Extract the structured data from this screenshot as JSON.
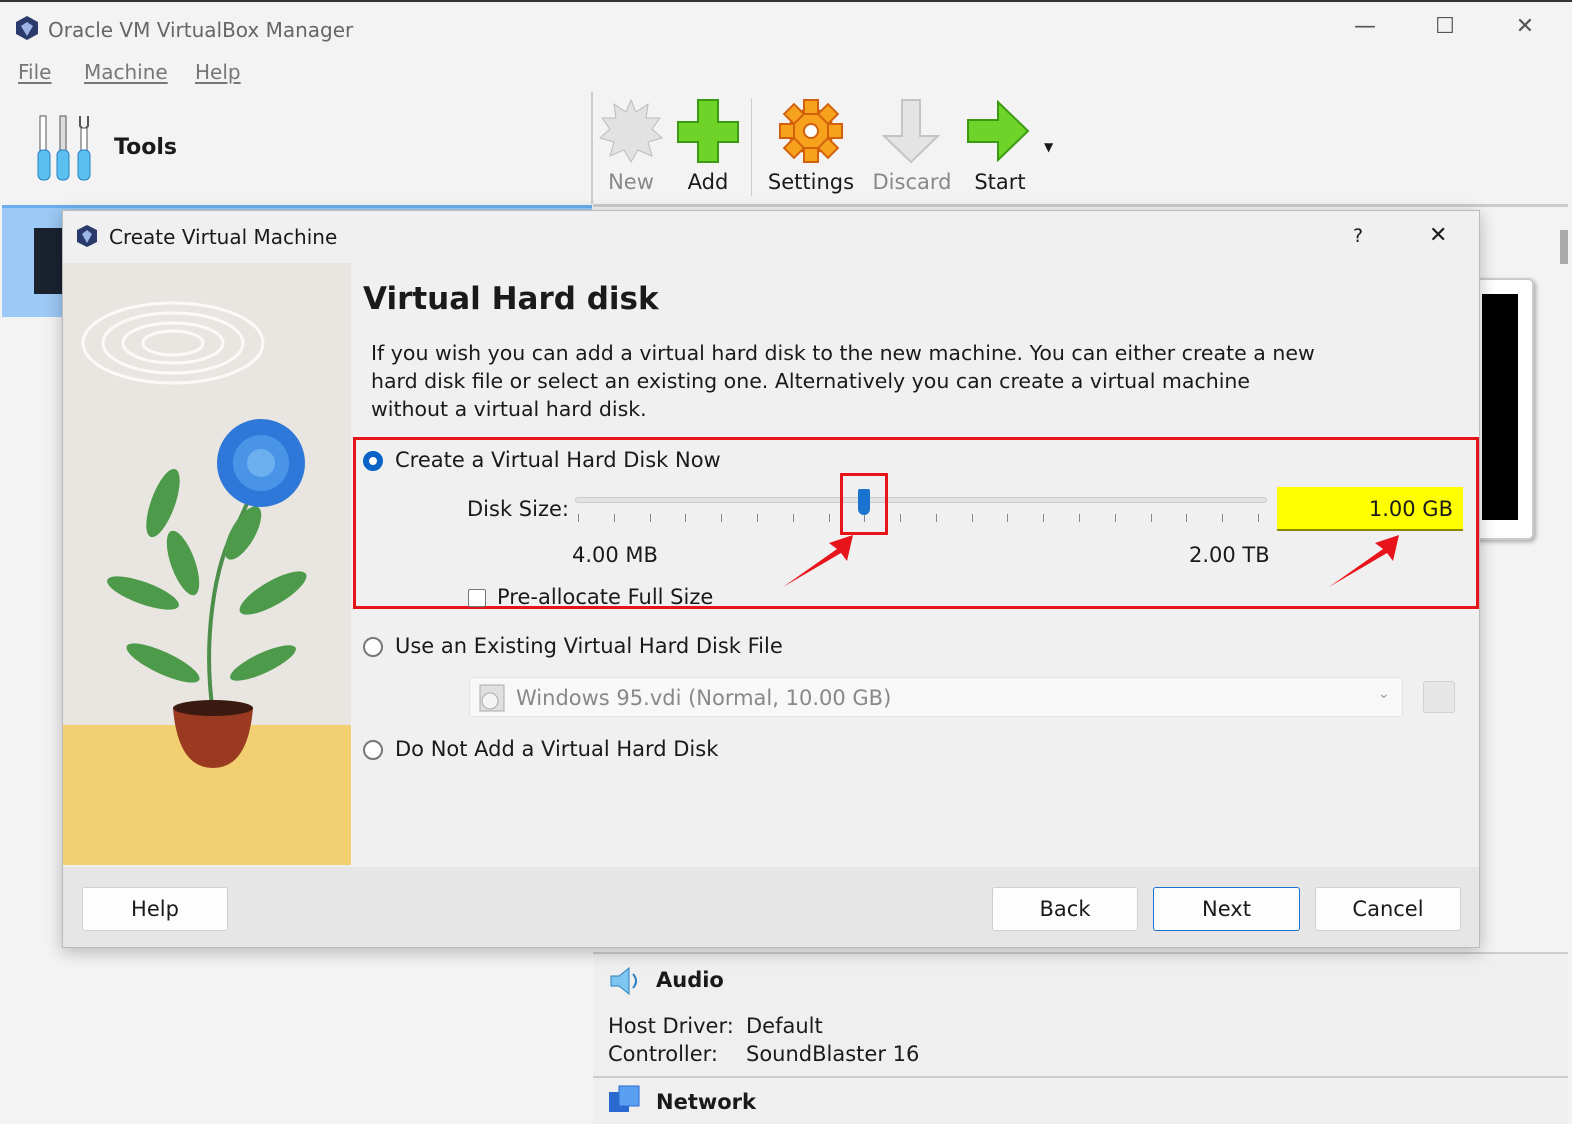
{
  "window": {
    "title": "Oracle VM VirtualBox Manager",
    "minimize": "—",
    "maximize": "☐",
    "close": "✕"
  },
  "menu": [
    "File",
    "Machine",
    "Help"
  ],
  "tools": {
    "label": "Tools"
  },
  "toolbar": [
    {
      "label": "New",
      "icon": "new-starburst-icon",
      "enabled": false
    },
    {
      "label": "Add",
      "icon": "add-plus-icon",
      "enabled": true
    },
    {
      "label": "Settings",
      "icon": "settings-gear-icon",
      "enabled": true
    },
    {
      "label": "Discard",
      "icon": "discard-arrow-icon",
      "enabled": false
    },
    {
      "label": "Start",
      "icon": "start-arrow-icon",
      "enabled": true
    }
  ],
  "dialog": {
    "title": "Create Virtual Machine",
    "help_glyph": "?",
    "close_glyph": "✕",
    "heading": "Virtual Hard disk",
    "description": "If you wish you can add a virtual hard disk to the new machine. You can either create a new hard disk file or select an existing one. Alternatively you can create a virtual machine without a virtual hard disk.",
    "options": {
      "create": {
        "label": "Create a Virtual Hard Disk Now",
        "selected": true
      },
      "existing": {
        "label": "Use an Existing Virtual Hard Disk File",
        "selected": false
      },
      "none": {
        "label": "Do Not Add a Virtual Hard Disk",
        "selected": false
      }
    },
    "disk_size": {
      "label": "Disk Size:",
      "value": "1.00 GB",
      "min_label": "4.00 MB",
      "max_label": "2.00 TB",
      "slider_fraction": 0.42
    },
    "preallocate": {
      "label": "Pre-allocate Full Size",
      "checked": false
    },
    "existing_file": {
      "value": "Windows 95.vdi (Normal, 10.00 GB)"
    },
    "buttons": {
      "help": "Help",
      "back": "Back",
      "next": "Next",
      "cancel": "Cancel"
    },
    "highlight_color": "#e8141c",
    "value_highlight": "#ffff00"
  },
  "details": {
    "audio": {
      "title": "Audio",
      "rows": [
        {
          "k": "Host Driver:",
          "v": "Default"
        },
        {
          "k": "Controller:",
          "v": "SoundBlaster 16"
        }
      ]
    },
    "network": {
      "title": "Network"
    }
  }
}
